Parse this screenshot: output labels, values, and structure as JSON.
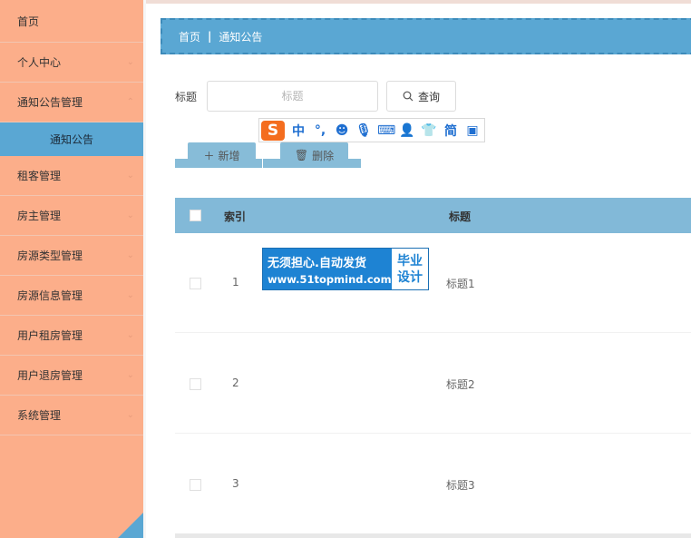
{
  "sidebar": {
    "items": [
      {
        "label": "首页"
      },
      {
        "label": "个人中心"
      },
      {
        "label": "通知公告管理"
      },
      {
        "label": "租客管理"
      },
      {
        "label": "房主管理"
      },
      {
        "label": "房源类型管理"
      },
      {
        "label": "房源信息管理"
      },
      {
        "label": "用户租房管理"
      },
      {
        "label": "用户退房管理"
      },
      {
        "label": "系统管理"
      }
    ],
    "active_sub": "通知公告"
  },
  "breadcrumb": {
    "home": "首页",
    "sep": "|",
    "current": "通知公告"
  },
  "search": {
    "label": "标题",
    "placeholder": "标题",
    "button": "查询"
  },
  "actions": {
    "add": "新增",
    "delete": "删除"
  },
  "table": {
    "headers": {
      "index": "索引",
      "title": "标题"
    },
    "rows": [
      {
        "index": "1",
        "title": "标题1"
      },
      {
        "index": "2",
        "title": "标题2"
      },
      {
        "index": "3",
        "title": "标题3"
      }
    ]
  },
  "ime": {
    "logo": "S",
    "mode": "中"
  },
  "watermark": {
    "line1": "无须担心.自动发货",
    "line2": "www.51topmind.com",
    "badge1": "毕业",
    "badge2": "设计"
  },
  "colors": {
    "sidebar": "#fcae8a",
    "accent": "#5aa7d3",
    "header": "#82b9d8"
  }
}
